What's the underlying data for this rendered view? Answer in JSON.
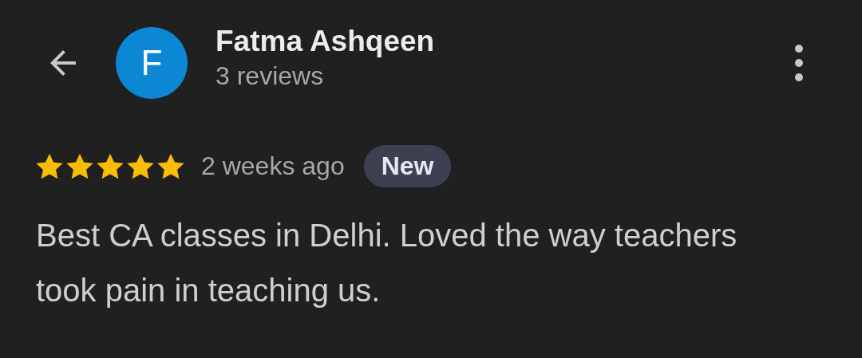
{
  "reviewer": {
    "initial": "F",
    "name": "Fatma Ashqeen",
    "reviews": "3 reviews"
  },
  "review": {
    "stars": 5,
    "time": "2 weeks ago",
    "badge": "New",
    "text": "Best CA classes in Delhi. Loved the way teachers took pain in teaching us."
  }
}
